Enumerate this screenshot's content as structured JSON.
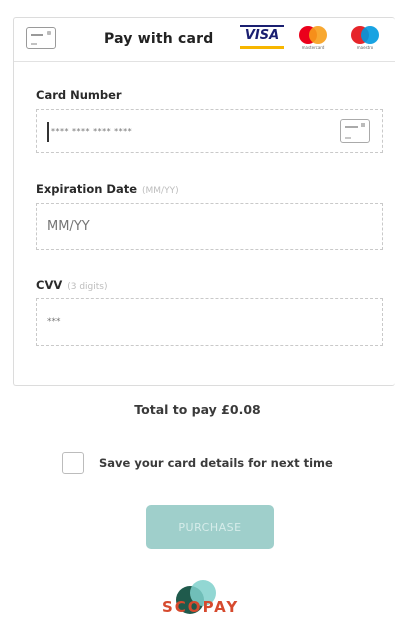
{
  "header": {
    "title": "Pay with card",
    "card_icon": "credit-card-icon",
    "brands": [
      "VISA",
      "mastercard",
      "maestro"
    ],
    "brand_colors": {
      "visa_blue": "#1a1f71",
      "visa_gold": "#f7b600",
      "mastercard_red": "#eb001b",
      "mastercard_orange": "#f79e1b",
      "maestro_red": "#e6252a",
      "maestro_blue": "#0099df"
    }
  },
  "form": {
    "card_number": {
      "label": "Card Number",
      "placeholder": "**** **** **** ****",
      "icon": "credit-card-icon"
    },
    "expiration": {
      "label": "Expiration Date",
      "hint": "(MM/YY)",
      "placeholder": "MM/YY"
    },
    "cvv": {
      "label": "CVV",
      "hint": "(3 digits)",
      "placeholder": "***"
    }
  },
  "total": {
    "text": "Total to pay £0.08"
  },
  "save_card": {
    "label": "Save your card details for next time",
    "checked": false
  },
  "purchase_button": {
    "label": "PURCHASE",
    "color": "#9fcfcb",
    "enabled": false
  },
  "footer": {
    "brand": "SCOPAY",
    "brand_color": "#d64a2e"
  }
}
